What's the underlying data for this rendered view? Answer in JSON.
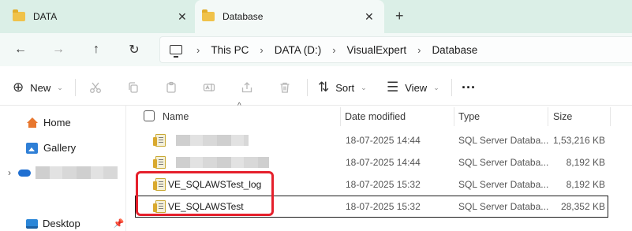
{
  "tabs": [
    {
      "label": "DATA",
      "close": "✕"
    },
    {
      "label": "Database",
      "close": "✕"
    }
  ],
  "new_tab": "+",
  "nav": {
    "back": "←",
    "forward": "→",
    "up": "↑",
    "refresh": "↻"
  },
  "breadcrumb": [
    "This PC",
    "DATA (D:)",
    "VisualExpert",
    "Database"
  ],
  "breadcrumb_sep": "›",
  "toolbar": {
    "new_label": "New",
    "sort_label": "Sort",
    "view_label": "View",
    "more": "···"
  },
  "sidebar": {
    "home": "Home",
    "gallery": "Gallery",
    "desktop": "Desktop"
  },
  "columns": {
    "name": "Name",
    "date_modified": "Date modified",
    "type": "Type",
    "size": "Size"
  },
  "files": [
    {
      "name": "",
      "date": "18-07-2025 14:44",
      "type": "SQL Server Databa...",
      "size": "1,53,216 KB"
    },
    {
      "name": "",
      "date": "18-07-2025 14:44",
      "type": "SQL Server Databa...",
      "size": "8,192 KB"
    },
    {
      "name": "VE_SQLAWSTest_log",
      "date": "18-07-2025 15:32",
      "type": "SQL Server Databa...",
      "size": "8,192 KB"
    },
    {
      "name": "VE_SQLAWSTest",
      "date": "18-07-2025 15:32",
      "type": "SQL Server Databa...",
      "size": "28,352 KB"
    }
  ],
  "colors": {
    "tabbar": "#dbefe7",
    "nav": "#f3f9f7",
    "folder": "#f0c24a",
    "highlight": "#e5202c"
  }
}
